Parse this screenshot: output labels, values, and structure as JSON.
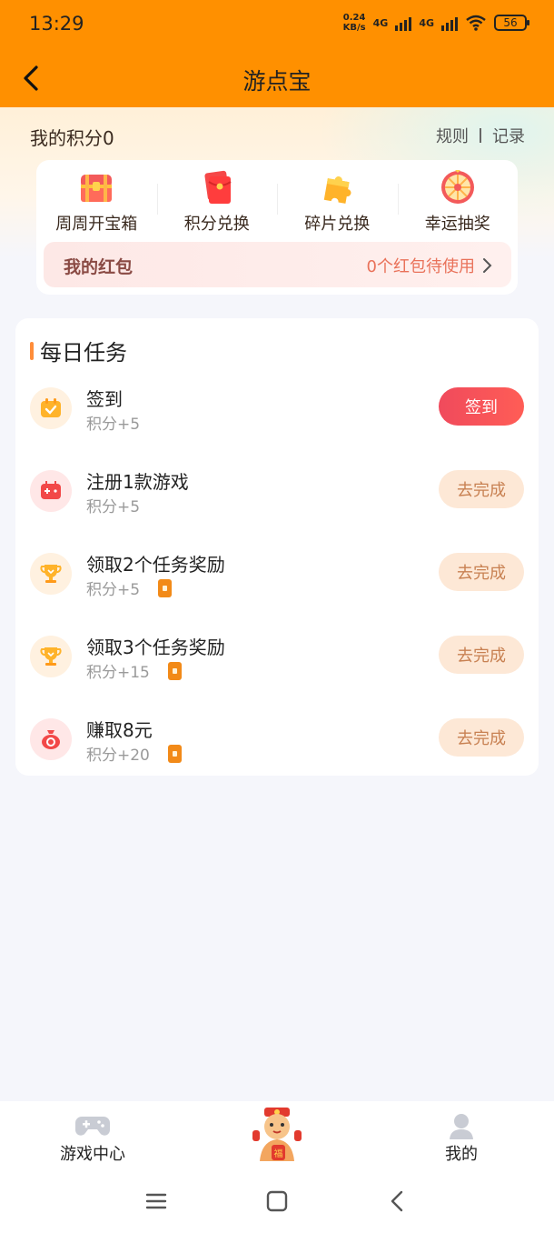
{
  "status": {
    "time": "13:29",
    "net_speed_value": "0.24",
    "net_speed_unit": "KB/s",
    "net_type_1": "4G",
    "net_type_2": "4G",
    "battery": "56"
  },
  "header": {
    "title": "游点宝",
    "back_icon": "chevron-left-icon"
  },
  "points": {
    "label": "我的积分0",
    "rules_label": "规则",
    "records_label": "记录"
  },
  "features": [
    {
      "label": "周周开宝箱",
      "icon": "treasure-chest-icon"
    },
    {
      "label": "积分兑换",
      "icon": "red-envelope-icon"
    },
    {
      "label": "碎片兑换",
      "icon": "puzzle-icon"
    },
    {
      "label": "幸运抽奖",
      "icon": "lucky-wheel-icon"
    }
  ],
  "redpacket": {
    "title": "我的红包",
    "value": "0个红包待使用"
  },
  "tasks": {
    "heading": "每日任务",
    "items": [
      {
        "name": "签到",
        "reward": "积分+5",
        "button": "签到",
        "has_coupon": false,
        "icon": "calendar-check-icon"
      },
      {
        "name": "注册1款游戏",
        "reward": "积分+5",
        "button": "去完成",
        "has_coupon": false,
        "icon": "game-console-icon"
      },
      {
        "name": "领取2个任务奖励",
        "reward": "积分+5",
        "button": "去完成",
        "has_coupon": true,
        "icon": "trophy-icon"
      },
      {
        "name": "领取3个任务奖励",
        "reward": "积分+15",
        "button": "去完成",
        "has_coupon": true,
        "icon": "trophy-icon"
      },
      {
        "name": "赚取8元",
        "reward": "积分+20",
        "button": "去完成",
        "has_coupon": true,
        "icon": "money-bag-icon"
      }
    ]
  },
  "bottom_nav": {
    "game_center": "游戏中心",
    "mine": "我的",
    "center_icon": "mascot-icon",
    "mascot_badge": "福"
  },
  "colors": {
    "accent": "#ff9000",
    "primary_button": "#f04a5c",
    "secondary_button_bg": "#fde8d6",
    "secondary_button_text": "#c88152"
  }
}
